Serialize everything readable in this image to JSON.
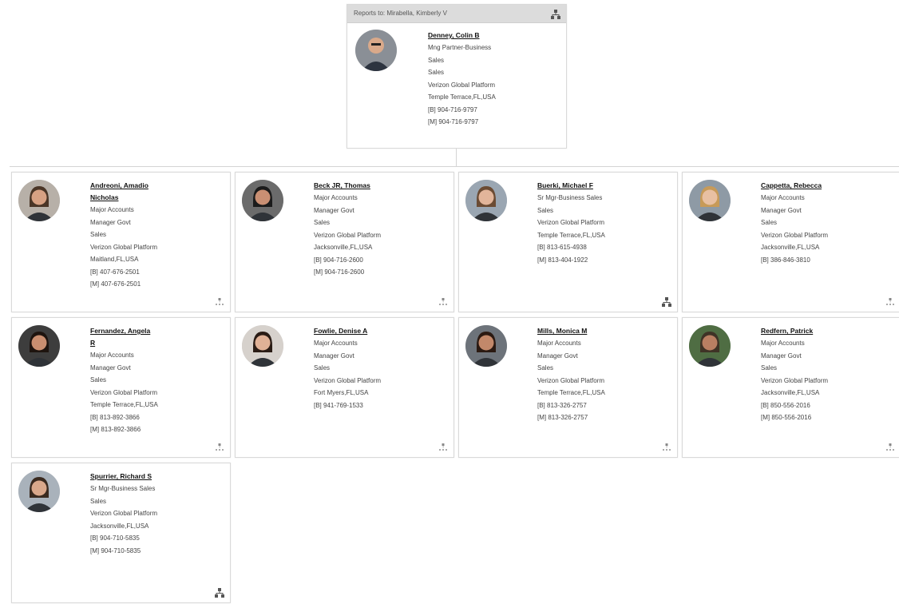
{
  "manager": {
    "reports_to": "Reports to: Mirabella, Kimberly V",
    "name": "Denney, Colin B",
    "lines": [
      "Mng Partner-Business",
      "Sales",
      "Sales",
      "Verizon Global Platform",
      "Temple Terrace,FL,USA",
      "[B] 904-716-9797",
      "[M] 904-716-9797"
    ]
  },
  "reports": [
    {
      "name_lines": [
        "Andreoni, Amadio",
        "Nicholas"
      ],
      "lines": [
        "Major Accounts",
        "Manager Govt",
        "Sales",
        "Verizon Global Platform",
        "Maitland,FL,USA",
        "[B] 407-676-2501",
        "[M] 407-676-2501"
      ],
      "icon": "small-org-icon"
    },
    {
      "name_lines": [
        "Beck JR, Thomas"
      ],
      "lines": [
        "Major Accounts",
        "Manager Govt",
        "Sales",
        "Verizon Global Platform",
        "Jacksonville,FL,USA",
        "[B] 904-716-2600",
        "[M] 904-716-2600"
      ],
      "icon": "small-org-icon"
    },
    {
      "name_lines": [
        "Buerki, Michael F"
      ],
      "lines": [
        "Sr Mgr-Business Sales",
        "Sales",
        "Verizon Global Platform",
        "Temple Terrace,FL,USA",
        "[B] 813-615-4938",
        "[M] 813-404-1922"
      ],
      "icon": "org-chart-icon"
    },
    {
      "name_lines": [
        "Cappetta, Rebecca"
      ],
      "lines": [
        "Major Accounts",
        "Manager Govt",
        "Sales",
        "Verizon Global Platform",
        "Jacksonville,FL,USA",
        "[B] 386-846-3810"
      ],
      "icon": "small-org-icon"
    },
    {
      "name_lines": [
        "Fernandez, Angela",
        "R"
      ],
      "lines": [
        "Major Accounts",
        "Manager Govt",
        "Sales",
        "Verizon Global Platform",
        "Temple Terrace,FL,USA",
        "[B] 813-892-3866",
        "[M] 813-892-3866"
      ],
      "icon": "small-org-icon"
    },
    {
      "name_lines": [
        "Fowlie, Denise A"
      ],
      "lines": [
        "Major Accounts",
        "Manager Govt",
        "Sales",
        "Verizon Global Platform",
        "Fort Myers,FL,USA",
        "[B] 941-769-1533"
      ],
      "icon": "small-org-icon"
    },
    {
      "name_lines": [
        "Mills, Monica M"
      ],
      "lines": [
        "Major Accounts",
        "Manager Govt",
        "Sales",
        "Verizon Global Platform",
        "Temple Terrace,FL,USA",
        "[B] 813-326-2757",
        "[M] 813-326-2757"
      ],
      "icon": "small-org-icon"
    },
    {
      "name_lines": [
        "Redfern, Patrick"
      ],
      "lines": [
        "Major Accounts",
        "Manager Govt",
        "Sales",
        "Verizon Global Platform",
        "Jacksonville,FL,USA",
        "[B] 850-556-2016",
        "[M] 850-556-2016"
      ],
      "icon": "small-org-icon"
    },
    {
      "name_lines": [
        "Spurrier, Richard S"
      ],
      "lines": [
        "Sr Mgr-Business Sales",
        "Sales",
        "Verizon Global Platform",
        "Jacksonville,FL,USA",
        "[B] 904-710-5835",
        "[M] 904-710-5835"
      ],
      "icon": "org-chart-icon"
    }
  ],
  "colors": {
    "header_bg": "#dcdcdc",
    "border": "#d9d9d9",
    "org_icon": "#555555"
  }
}
